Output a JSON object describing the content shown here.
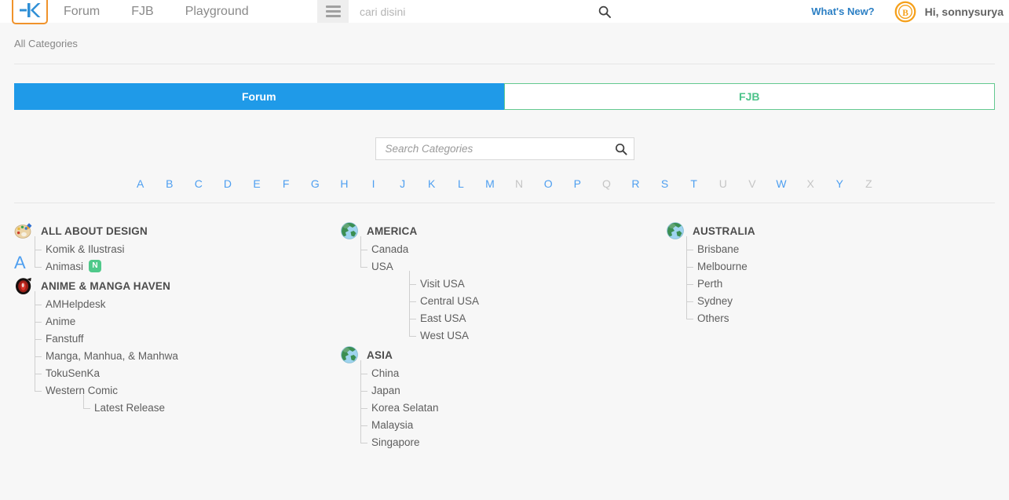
{
  "header": {
    "logo_alt": "kaskus-logo",
    "nav": [
      {
        "label": "Forum"
      },
      {
        "label": "FJB"
      },
      {
        "label": "Playground"
      }
    ],
    "search_placeholder": "cari disini",
    "search_value": "",
    "whats_new": "What's New?",
    "username": "Hi, sonnysurya"
  },
  "breadcrumb": {
    "items": [
      "All Categories"
    ]
  },
  "tabs": [
    {
      "label": "Forum",
      "active": true
    },
    {
      "label": "FJB",
      "active": false
    }
  ],
  "category_search": {
    "placeholder": "Search Categories",
    "value": ""
  },
  "alphabet": [
    {
      "letter": "A",
      "enabled": true
    },
    {
      "letter": "B",
      "enabled": true
    },
    {
      "letter": "C",
      "enabled": true
    },
    {
      "letter": "D",
      "enabled": true
    },
    {
      "letter": "E",
      "enabled": true
    },
    {
      "letter": "F",
      "enabled": true
    },
    {
      "letter": "G",
      "enabled": true
    },
    {
      "letter": "H",
      "enabled": true
    },
    {
      "letter": "I",
      "enabled": true
    },
    {
      "letter": "J",
      "enabled": true
    },
    {
      "letter": "K",
      "enabled": true
    },
    {
      "letter": "L",
      "enabled": true
    },
    {
      "letter": "M",
      "enabled": true
    },
    {
      "letter": "N",
      "enabled": false
    },
    {
      "letter": "O",
      "enabled": true
    },
    {
      "letter": "P",
      "enabled": true
    },
    {
      "letter": "Q",
      "enabled": false
    },
    {
      "letter": "R",
      "enabled": true
    },
    {
      "letter": "S",
      "enabled": true
    },
    {
      "letter": "T",
      "enabled": true
    },
    {
      "letter": "U",
      "enabled": false
    },
    {
      "letter": "V",
      "enabled": false
    },
    {
      "letter": "W",
      "enabled": true
    },
    {
      "letter": "X",
      "enabled": false
    },
    {
      "letter": "Y",
      "enabled": true
    },
    {
      "letter": "Z",
      "enabled": false
    }
  ],
  "section_letter": "A",
  "columns": [
    {
      "blocks": [
        {
          "icon": "palette-icon",
          "title": "ALL ABOUT DESIGN",
          "subs": [
            {
              "label": "Komik & Ilustrasi"
            },
            {
              "label": "Animasi",
              "badge": "N"
            }
          ]
        },
        {
          "icon": "anime-eye-icon",
          "title": "ANIME & MANGA HAVEN",
          "subs": [
            {
              "label": "AMHelpdesk"
            },
            {
              "label": "Anime"
            },
            {
              "label": "Fanstuff"
            },
            {
              "label": "Manga, Manhua, & Manhwa"
            },
            {
              "label": "TokuSenKa"
            },
            {
              "label": "Western Comic",
              "children": [
                {
                  "label": "Latest Release"
                }
              ]
            }
          ]
        }
      ]
    },
    {
      "blocks": [
        {
          "icon": "globe-icon",
          "title": "AMERICA",
          "subs": [
            {
              "label": "Canada"
            },
            {
              "label": "USA",
              "children": [
                {
                  "label": "Visit USA"
                },
                {
                  "label": "Central USA"
                },
                {
                  "label": "East USA"
                },
                {
                  "label": "West USA"
                }
              ]
            }
          ]
        },
        {
          "icon": "globe-icon",
          "title": "ASIA",
          "subs": [
            {
              "label": "China"
            },
            {
              "label": "Japan"
            },
            {
              "label": "Korea Selatan"
            },
            {
              "label": "Malaysia"
            },
            {
              "label": "Singapore"
            }
          ]
        }
      ]
    },
    {
      "blocks": [
        {
          "icon": "globe-icon",
          "title": "AUSTRALIA",
          "subs": [
            {
              "label": "Brisbane"
            },
            {
              "label": "Melbourne"
            },
            {
              "label": "Perth"
            },
            {
              "label": "Sydney"
            },
            {
              "label": "Others"
            }
          ]
        }
      ]
    }
  ],
  "colors": {
    "accent_blue": "#1f9ae8",
    "link_blue": "#4e9ff0",
    "green": "#4fc98a",
    "orange": "#f0932b",
    "text_gray": "#5e5e5e"
  }
}
